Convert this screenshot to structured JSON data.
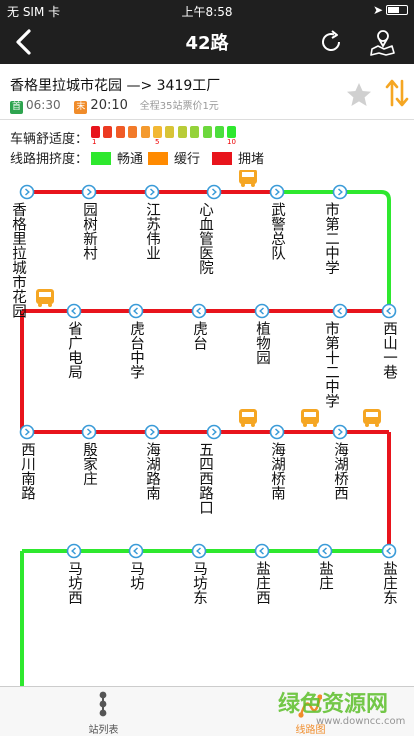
{
  "status": {
    "carrier": "无 SIM 卡",
    "time": "上午8:58"
  },
  "nav": {
    "title": "42路",
    "back_icon": "chevron-left-icon",
    "refresh_icon": "refresh-icon",
    "map_icon": "map-pin-icon"
  },
  "route": {
    "from_to": "香格里拉城市花园 —> 3419工厂",
    "first_tag": "首",
    "first_time": "06:30",
    "last_tag": "末",
    "last_time": "20:10",
    "summary": "全程35站票价1元"
  },
  "legend": {
    "comfort_label": "车辆舒适度：",
    "congestion_label": "线路拥挤度：",
    "scale_marks": [
      "1",
      "5",
      "10"
    ],
    "smooth": "畅通",
    "slow": "缓行",
    "jam": "拥堵"
  },
  "colors": {
    "smooth": "#2ee82e",
    "slow": "#ff8a00",
    "jam": "#e8141c",
    "node": "#3a9bd8",
    "bus": "#f5a623"
  },
  "stops": {
    "row1": [
      "香格里拉城市花园",
      "园树新村",
      "江苏伟业",
      "心血管医院",
      "武警总队",
      "市第二中学"
    ],
    "row2": [
      "西山一巷",
      "市第十二中学",
      "植物园",
      "虎台",
      "虎台中学",
      "省广电局"
    ],
    "row3": [
      "西川南路",
      "殷家庄",
      "海湖路南",
      "五四西路口",
      "海湖桥南",
      "海湖桥西"
    ],
    "row4": [
      "盐庄东",
      "盐庄",
      "盐庄西",
      "马坊东",
      "马坊",
      "马坊西"
    ]
  },
  "tabs": [
    {
      "label": "站列表"
    },
    {
      "label": "线路图"
    }
  ],
  "watermark": {
    "brand": "绿色资源网",
    "url": "www.downcc.com"
  }
}
